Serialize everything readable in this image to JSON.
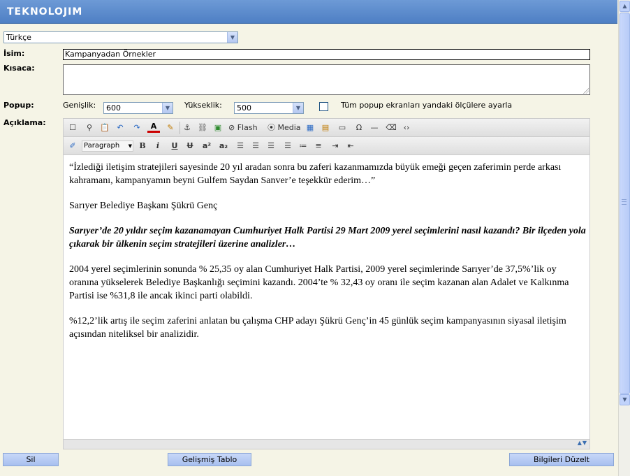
{
  "app": {
    "logo": "TEKNOLOJIM"
  },
  "language_select": {
    "value": "Türkçe"
  },
  "form": {
    "name_label": "İsim:",
    "name_value": "Kampanyadan Örnekler",
    "summary_label": "Kısaca:",
    "summary_value": "",
    "popup_label": "Popup:",
    "width_label": "Genişlik:",
    "width_value": "600",
    "height_label": "Yükseklik:",
    "height_value": "500",
    "apply_all_label": "Tüm popup ekranları yandaki ölçülere ayarla",
    "description_label": "Açıklama:"
  },
  "editor": {
    "toolbar1": {
      "flash_label": "Flash",
      "media_label": "Media"
    },
    "toolbar2": {
      "format_value": "Paragraph",
      "bold": "B",
      "italic": "i",
      "underline": "U",
      "strike": "U",
      "superscript": "a²",
      "subscript": "a₂"
    },
    "paragraphs": [
      {
        "text": "“İzlediği iletişim stratejileri sayesinde 20 yıl aradan sonra bu zaferi kazanmamızda büyük emeği geçen zaferimin perde arkası kahramanı, kampanyamın beyni Gulfem Saydan Sanver’e teşekkür ederim…”",
        "style": "normal"
      },
      {
        "text": "Sarıyer Belediye Başkanı Şükrü Genç",
        "style": "normal"
      },
      {
        "text": " Sarıyer’de 20 yıldır seçim kazanamayan Cumhuriyet Halk Partisi 29 Mart 2009 yerel seçimlerini nasıl kazandı? Bir ilçeden yola çıkarak bir ülkenin seçim stratejileri üzerine analizler…",
        "style": "bold"
      },
      {
        "text": " 2004 yerel seçimlerinin sonunda % 25,35 oy alan Cumhuriyet Halk Partisi, 2009 yerel seçimlerinde Sarıyer’de 37,5%’lik oy oranına yükselerek Belediye Başkanlığı seçimini kazandı. 2004’te % 32,43 oy oranı ile seçim kazanan alan Adalet ve Kalkınma Partisi ise %31,8 ile ancak ikinci parti olabildi.",
        "style": "normal"
      },
      {
        "text": " %12,2’lik artış ile seçim zaferini anlatan bu çalışma CHP adayı Şükrü Genç’in 45 günlük seçim kampanyasının siyasal iletişim açısından niteliksel bir analizidir.",
        "style": "normal"
      }
    ]
  },
  "buttons": {
    "delete": "Sil",
    "advanced_table": "Gelişmiş Tablo",
    "update": "Bilgileri Düzelt"
  },
  "colors": {
    "titlebar": "#4e7fc4",
    "background": "#f5f4e6",
    "button": "#b3c8f2"
  }
}
